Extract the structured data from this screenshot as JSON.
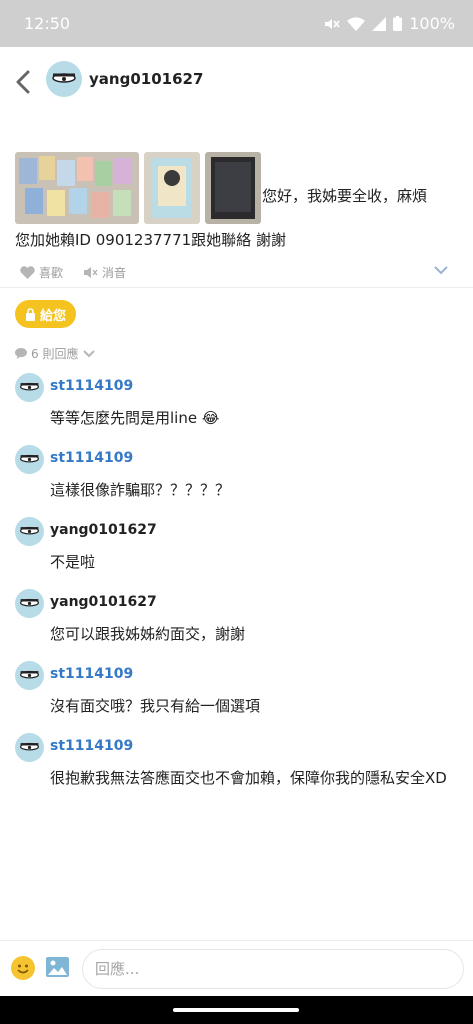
{
  "status_bar": {
    "time": "12:50",
    "battery": "100%"
  },
  "header": {
    "username": "yang0101627"
  },
  "post": {
    "text_line1": "您好，我姊要全收，麻煩",
    "text_line2": "您加她賴ID 0901237771跟她聯絡 謝謝",
    "like_label": "喜歡",
    "mute_label": "消音"
  },
  "give_button": "給您",
  "reply_count": "6 則回應",
  "comments": [
    {
      "name": "st1114109",
      "text": "等等怎麼先問是用line 😂"
    },
    {
      "name": "st1114109",
      "text": "這樣很像詐騙耶？？？？？"
    },
    {
      "name": "yang0101627",
      "text": "不是啦"
    },
    {
      "name": "yang0101627",
      "text": "您可以跟我姊姊約面交，謝謝"
    },
    {
      "name": "st1114109",
      "text": "沒有面交哦？我只有給一個選項"
    },
    {
      "name": "st1114109",
      "text": "很抱歉我無法答應面交也不會加賴，保障你我的隱私安全XD"
    }
  ],
  "composer": {
    "placeholder": "回應..."
  },
  "colors": {
    "accent_yellow": "#f5c320",
    "link_blue": "#3579c6",
    "avatar_bg": "#b7dbe7"
  }
}
